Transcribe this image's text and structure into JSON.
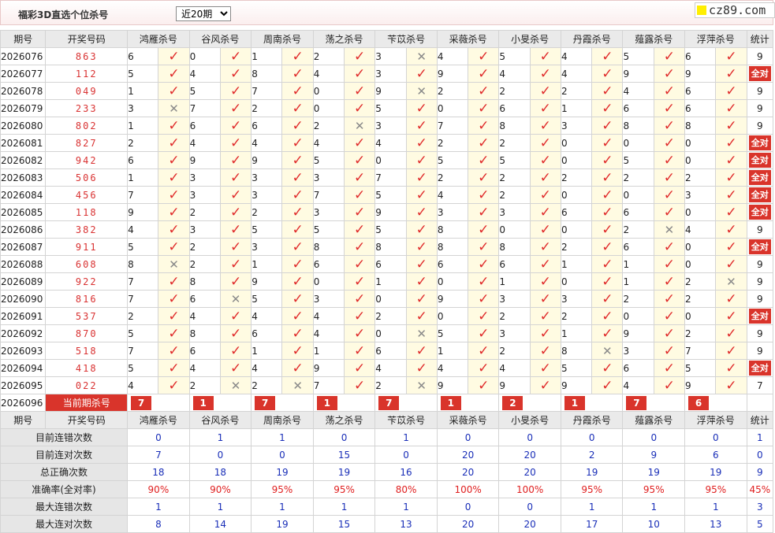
{
  "header": {
    "title": "福彩3D直选个位杀号",
    "range_selected": "近20期",
    "logo_text": "cz89.com"
  },
  "columns": [
    "期号",
    "开奖号码",
    "鸿雁杀号",
    "谷风杀号",
    "周南杀号",
    "荡之杀号",
    "苄苡杀号",
    "采薇杀号",
    "小旻杀号",
    "丹霞杀号",
    "薤露杀号",
    "浮萍杀号",
    "统计"
  ],
  "rows": [
    {
      "period": "2026076",
      "number": "863",
      "picks": [
        [
          6,
          1
        ],
        [
          0,
          1
        ],
        [
          1,
          1
        ],
        [
          2,
          1
        ],
        [
          3,
          0
        ],
        [
          4,
          1
        ],
        [
          5,
          1
        ],
        [
          4,
          1
        ],
        [
          5,
          1
        ],
        [
          6,
          1
        ]
      ],
      "stat": "9"
    },
    {
      "period": "2026077",
      "number": "112",
      "picks": [
        [
          5,
          1
        ],
        [
          4,
          1
        ],
        [
          8,
          1
        ],
        [
          4,
          1
        ],
        [
          3,
          1
        ],
        [
          9,
          1
        ],
        [
          4,
          1
        ],
        [
          4,
          1
        ],
        [
          9,
          1
        ],
        [
          9,
          1
        ]
      ],
      "stat": "全对"
    },
    {
      "period": "2026078",
      "number": "049",
      "picks": [
        [
          1,
          1
        ],
        [
          5,
          1
        ],
        [
          7,
          1
        ],
        [
          0,
          1
        ],
        [
          9,
          0
        ],
        [
          2,
          1
        ],
        [
          2,
          1
        ],
        [
          2,
          1
        ],
        [
          4,
          1
        ],
        [
          6,
          1
        ]
      ],
      "stat": "9"
    },
    {
      "period": "2026079",
      "number": "233",
      "picks": [
        [
          3,
          0
        ],
        [
          7,
          1
        ],
        [
          2,
          1
        ],
        [
          0,
          1
        ],
        [
          5,
          1
        ],
        [
          0,
          1
        ],
        [
          6,
          1
        ],
        [
          1,
          1
        ],
        [
          6,
          1
        ],
        [
          6,
          1
        ]
      ],
      "stat": "9"
    },
    {
      "period": "2026080",
      "number": "802",
      "picks": [
        [
          1,
          1
        ],
        [
          6,
          1
        ],
        [
          6,
          1
        ],
        [
          2,
          0
        ],
        [
          3,
          1
        ],
        [
          7,
          1
        ],
        [
          8,
          1
        ],
        [
          3,
          1
        ],
        [
          8,
          1
        ],
        [
          8,
          1
        ]
      ],
      "stat": "9"
    },
    {
      "period": "2026081",
      "number": "827",
      "picks": [
        [
          2,
          1
        ],
        [
          4,
          1
        ],
        [
          4,
          1
        ],
        [
          4,
          1
        ],
        [
          4,
          1
        ],
        [
          2,
          1
        ],
        [
          2,
          1
        ],
        [
          0,
          1
        ],
        [
          0,
          1
        ],
        [
          0,
          1
        ]
      ],
      "stat": "全对"
    },
    {
      "period": "2026082",
      "number": "942",
      "picks": [
        [
          6,
          1
        ],
        [
          9,
          1
        ],
        [
          9,
          1
        ],
        [
          5,
          1
        ],
        [
          0,
          1
        ],
        [
          5,
          1
        ],
        [
          5,
          1
        ],
        [
          0,
          1
        ],
        [
          5,
          1
        ],
        [
          0,
          1
        ]
      ],
      "stat": "全对"
    },
    {
      "period": "2026083",
      "number": "506",
      "picks": [
        [
          1,
          1
        ],
        [
          3,
          1
        ],
        [
          3,
          1
        ],
        [
          3,
          1
        ],
        [
          7,
          1
        ],
        [
          2,
          1
        ],
        [
          2,
          1
        ],
        [
          2,
          1
        ],
        [
          2,
          1
        ],
        [
          2,
          1
        ]
      ],
      "stat": "全对"
    },
    {
      "period": "2026084",
      "number": "456",
      "picks": [
        [
          7,
          1
        ],
        [
          3,
          1
        ],
        [
          3,
          1
        ],
        [
          7,
          1
        ],
        [
          5,
          1
        ],
        [
          4,
          1
        ],
        [
          2,
          1
        ],
        [
          0,
          1
        ],
        [
          0,
          1
        ],
        [
          3,
          1
        ]
      ],
      "stat": "全对"
    },
    {
      "period": "2026085",
      "number": "118",
      "picks": [
        [
          9,
          1
        ],
        [
          2,
          1
        ],
        [
          2,
          1
        ],
        [
          3,
          1
        ],
        [
          9,
          1
        ],
        [
          3,
          1
        ],
        [
          3,
          1
        ],
        [
          6,
          1
        ],
        [
          6,
          1
        ],
        [
          0,
          1
        ]
      ],
      "stat": "全对"
    },
    {
      "period": "2026086",
      "number": "382",
      "picks": [
        [
          4,
          1
        ],
        [
          3,
          1
        ],
        [
          5,
          1
        ],
        [
          5,
          1
        ],
        [
          5,
          1
        ],
        [
          8,
          1
        ],
        [
          0,
          1
        ],
        [
          0,
          1
        ],
        [
          2,
          0
        ],
        [
          4,
          1
        ]
      ],
      "stat": "9"
    },
    {
      "period": "2026087",
      "number": "911",
      "picks": [
        [
          5,
          1
        ],
        [
          2,
          1
        ],
        [
          3,
          1
        ],
        [
          8,
          1
        ],
        [
          8,
          1
        ],
        [
          8,
          1
        ],
        [
          8,
          1
        ],
        [
          2,
          1
        ],
        [
          6,
          1
        ],
        [
          0,
          1
        ]
      ],
      "stat": "全对"
    },
    {
      "period": "2026088",
      "number": "608",
      "picks": [
        [
          8,
          0
        ],
        [
          2,
          1
        ],
        [
          1,
          1
        ],
        [
          6,
          1
        ],
        [
          6,
          1
        ],
        [
          6,
          1
        ],
        [
          6,
          1
        ],
        [
          1,
          1
        ],
        [
          1,
          1
        ],
        [
          0,
          1
        ]
      ],
      "stat": "9"
    },
    {
      "period": "2026089",
      "number": "922",
      "picks": [
        [
          7,
          1
        ],
        [
          8,
          1
        ],
        [
          9,
          1
        ],
        [
          0,
          1
        ],
        [
          1,
          1
        ],
        [
          0,
          1
        ],
        [
          1,
          1
        ],
        [
          0,
          1
        ],
        [
          1,
          1
        ],
        [
          2,
          0
        ]
      ],
      "stat": "9"
    },
    {
      "period": "2026090",
      "number": "816",
      "picks": [
        [
          7,
          1
        ],
        [
          6,
          0
        ],
        [
          5,
          1
        ],
        [
          3,
          1
        ],
        [
          0,
          1
        ],
        [
          9,
          1
        ],
        [
          3,
          1
        ],
        [
          3,
          1
        ],
        [
          2,
          1
        ],
        [
          2,
          1
        ]
      ],
      "stat": "9"
    },
    {
      "period": "2026091",
      "number": "537",
      "picks": [
        [
          2,
          1
        ],
        [
          4,
          1
        ],
        [
          4,
          1
        ],
        [
          4,
          1
        ],
        [
          2,
          1
        ],
        [
          0,
          1
        ],
        [
          2,
          1
        ],
        [
          2,
          1
        ],
        [
          0,
          1
        ],
        [
          0,
          1
        ]
      ],
      "stat": "全对"
    },
    {
      "period": "2026092",
      "number": "870",
      "picks": [
        [
          5,
          1
        ],
        [
          8,
          1
        ],
        [
          6,
          1
        ],
        [
          4,
          1
        ],
        [
          0,
          0
        ],
        [
          5,
          1
        ],
        [
          3,
          1
        ],
        [
          1,
          1
        ],
        [
          9,
          1
        ],
        [
          2,
          1
        ]
      ],
      "stat": "9"
    },
    {
      "period": "2026093",
      "number": "518",
      "picks": [
        [
          7,
          1
        ],
        [
          6,
          1
        ],
        [
          1,
          1
        ],
        [
          1,
          1
        ],
        [
          6,
          1
        ],
        [
          1,
          1
        ],
        [
          2,
          1
        ],
        [
          8,
          0
        ],
        [
          3,
          1
        ],
        [
          7,
          1
        ]
      ],
      "stat": "9"
    },
    {
      "period": "2026094",
      "number": "418",
      "picks": [
        [
          5,
          1
        ],
        [
          4,
          1
        ],
        [
          4,
          1
        ],
        [
          9,
          1
        ],
        [
          4,
          1
        ],
        [
          4,
          1
        ],
        [
          4,
          1
        ],
        [
          5,
          1
        ],
        [
          6,
          1
        ],
        [
          5,
          1
        ]
      ],
      "stat": "全对"
    },
    {
      "period": "2026095",
      "number": "022",
      "picks": [
        [
          4,
          1
        ],
        [
          2,
          0
        ],
        [
          2,
          0
        ],
        [
          7,
          1
        ],
        [
          2,
          0
        ],
        [
          9,
          1
        ],
        [
          9,
          1
        ],
        [
          9,
          1
        ],
        [
          4,
          1
        ],
        [
          9,
          1
        ]
      ],
      "stat": "7"
    }
  ],
  "current": {
    "period": "2026096",
    "label": "当前期杀号",
    "values": [
      "7",
      "1",
      "7",
      "1",
      "7",
      "1",
      "2",
      "1",
      "7",
      "6"
    ]
  },
  "summary": [
    {
      "label": "目前连错次数",
      "values": [
        "0",
        "1",
        "1",
        "0",
        "1",
        "0",
        "0",
        "0",
        "0",
        "0",
        "1"
      ],
      "red": false
    },
    {
      "label": "目前连对次数",
      "values": [
        "7",
        "0",
        "0",
        "15",
        "0",
        "20",
        "20",
        "2",
        "9",
        "6",
        "0"
      ],
      "red": false
    },
    {
      "label": "总正确次数",
      "values": [
        "18",
        "18",
        "19",
        "19",
        "16",
        "20",
        "20",
        "19",
        "19",
        "19",
        "9"
      ],
      "red": false
    },
    {
      "label": "准确率(全对率)",
      "values": [
        "90%",
        "90%",
        "95%",
        "95%",
        "80%",
        "100%",
        "100%",
        "95%",
        "95%",
        "95%",
        "45%"
      ],
      "red": true
    },
    {
      "label": "最大连错次数",
      "values": [
        "1",
        "1",
        "1",
        "1",
        "1",
        "0",
        "0",
        "1",
        "1",
        "1",
        "3"
      ],
      "red": false
    },
    {
      "label": "最大连对次数",
      "values": [
        "8",
        "14",
        "19",
        "15",
        "13",
        "20",
        "20",
        "17",
        "10",
        "13",
        "5"
      ],
      "red": false
    }
  ]
}
